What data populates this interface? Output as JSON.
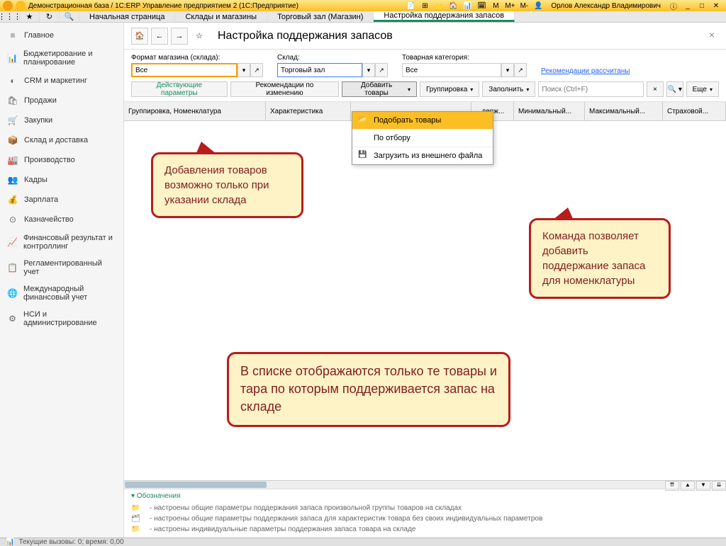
{
  "titlebar": {
    "text": "Демонстрационная база / 1С:ERP Управление предприятием 2  (1С:Предприятие)",
    "user": "Орлов Александр Владимирович",
    "m_btns": [
      "M",
      "M+",
      "M-"
    ]
  },
  "tabs": {
    "t0": "Начальная страница",
    "t1": "Склады и магазины",
    "t2": "Торговый зал (Магазин)",
    "t3": "Настройка поддержания запасов"
  },
  "sidebar": {
    "items": [
      {
        "icon": "≡",
        "label": "Главное"
      },
      {
        "icon": "📊",
        "label": "Бюджетирование и планирование"
      },
      {
        "icon": "◐",
        "label": "CRM и маркетинг"
      },
      {
        "icon": "🛍",
        "label": "Продажи"
      },
      {
        "icon": "🛒",
        "label": "Закупки"
      },
      {
        "icon": "📦",
        "label": "Склад и доставка"
      },
      {
        "icon": "🏭",
        "label": "Производство"
      },
      {
        "icon": "👥",
        "label": "Кадры"
      },
      {
        "icon": "💰",
        "label": "Зарплата"
      },
      {
        "icon": "⊙",
        "label": "Казначейство"
      },
      {
        "icon": "📈",
        "label": "Финансовый результат и контроллинг"
      },
      {
        "icon": "📋",
        "label": "Регламентированный учет"
      },
      {
        "icon": "🌐",
        "label": "Международный финансовый учет"
      },
      {
        "icon": "⚙",
        "label": "НСИ и администрирование"
      }
    ]
  },
  "page_title": "Настройка поддержания запасов",
  "filters": {
    "format_label": "Формат магазина (склада):",
    "format_value": "Все",
    "sklad_label": "Склад:",
    "sklad_value": "Торговый зал",
    "category_label": "Товарная категория:",
    "category_value": "Все",
    "recommendations": "Рекомендации рассчитаны"
  },
  "toolbar": {
    "active_params": "Действующие параметры",
    "recommendations": "Рекомендации по изменению",
    "add_goods": "Добавить товары",
    "grouping": "Группировка",
    "fill": "Заполнить",
    "search_placeholder": "Поиск (Ctrl+F)",
    "more": "Еще"
  },
  "dropdown": {
    "item1": "Подобрать товары",
    "item2": "По отбору",
    "item3": "Загрузить из внешнего файла"
  },
  "columns": {
    "c1": "Группировка, Номенклатура",
    "c2": "Характеристика",
    "c3": "",
    "c4": "...держ...",
    "c5": "Минимальный...",
    "c6": "Максимальный...",
    "c7": "Страховой..."
  },
  "callouts": {
    "c1": "Добавления товаров возможно только при указании склада",
    "c2": "Команда позволяет добавить поддержание запаса для номенклатуры",
    "c3": "В списке отображаются только те товары и тара по которым поддерживается запас на складе"
  },
  "legend": {
    "title": "Обозначения",
    "l1": "- настроены общие параметры поддержания запаса произвольной группы товаров на складах",
    "l2": "- настроены общие параметры поддержания запаса для характеристик товара без своих индивидуальных параметров",
    "l3": "- настроены индивидуальные параметры поддержания запаса товара на складе"
  },
  "statusbar": "Текущие вызовы: 0; время: 0,00"
}
